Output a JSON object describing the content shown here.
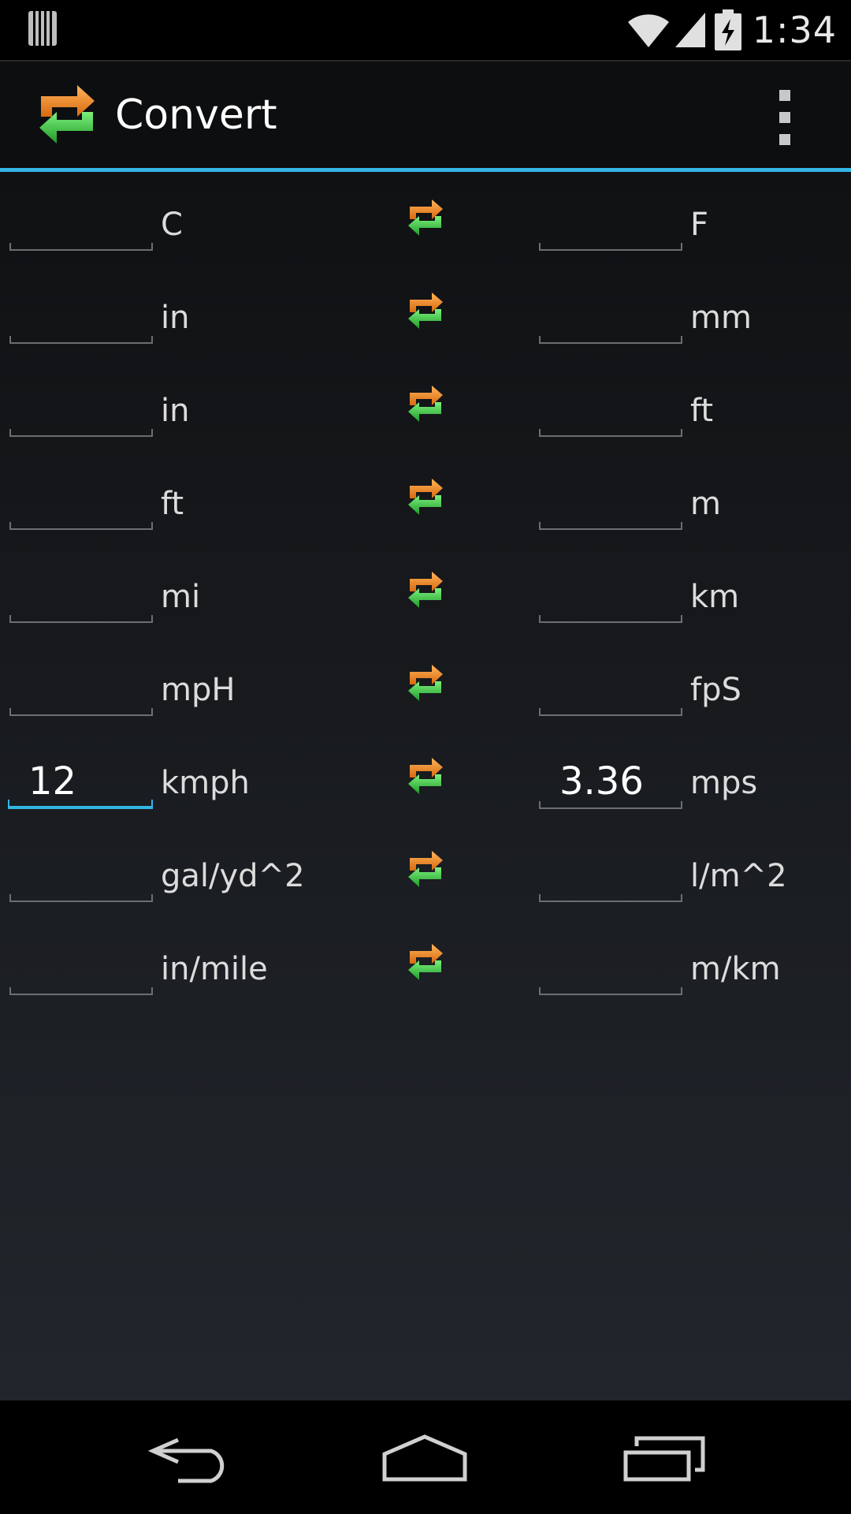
{
  "status_bar": {
    "time": "1:34",
    "icons": [
      "notification-icon",
      "wifi-icon",
      "signal-icon",
      "battery-charging-icon"
    ]
  },
  "action_bar": {
    "title": "Convert",
    "app_icon": "convert-arrows-icon",
    "overflow_icon": "overflow-menu-icon"
  },
  "colors": {
    "accent": "#33b5e5",
    "background_top": "#101113",
    "background_bottom": "#22262c",
    "swap_orange": "#f0821e",
    "swap_green": "#3cc83c"
  },
  "conversions": [
    {
      "left_value": "",
      "left_unit": "C",
      "right_value": "",
      "right_unit": "F"
    },
    {
      "left_value": "",
      "left_unit": "in",
      "right_value": "",
      "right_unit": "mm"
    },
    {
      "left_value": "",
      "left_unit": "in",
      "right_value": "",
      "right_unit": "ft"
    },
    {
      "left_value": "",
      "left_unit": "ft",
      "right_value": "",
      "right_unit": "m"
    },
    {
      "left_value": "",
      "left_unit": "mi",
      "right_value": "",
      "right_unit": "km"
    },
    {
      "left_value": "",
      "left_unit": "mpH",
      "right_value": "",
      "right_unit": "fpS"
    },
    {
      "left_value": "12",
      "left_unit": "kmph",
      "right_value": "3.36",
      "right_unit": "mps",
      "focused": true
    },
    {
      "left_value": "",
      "left_unit": "gal/yd^2",
      "right_value": "",
      "right_unit": "l/m^2"
    },
    {
      "left_value": "",
      "left_unit": "in/mile",
      "right_value": "",
      "right_unit": "m/km"
    }
  ],
  "nav_bar": {
    "icons": [
      "back-icon",
      "home-icon",
      "recent-apps-icon"
    ]
  }
}
